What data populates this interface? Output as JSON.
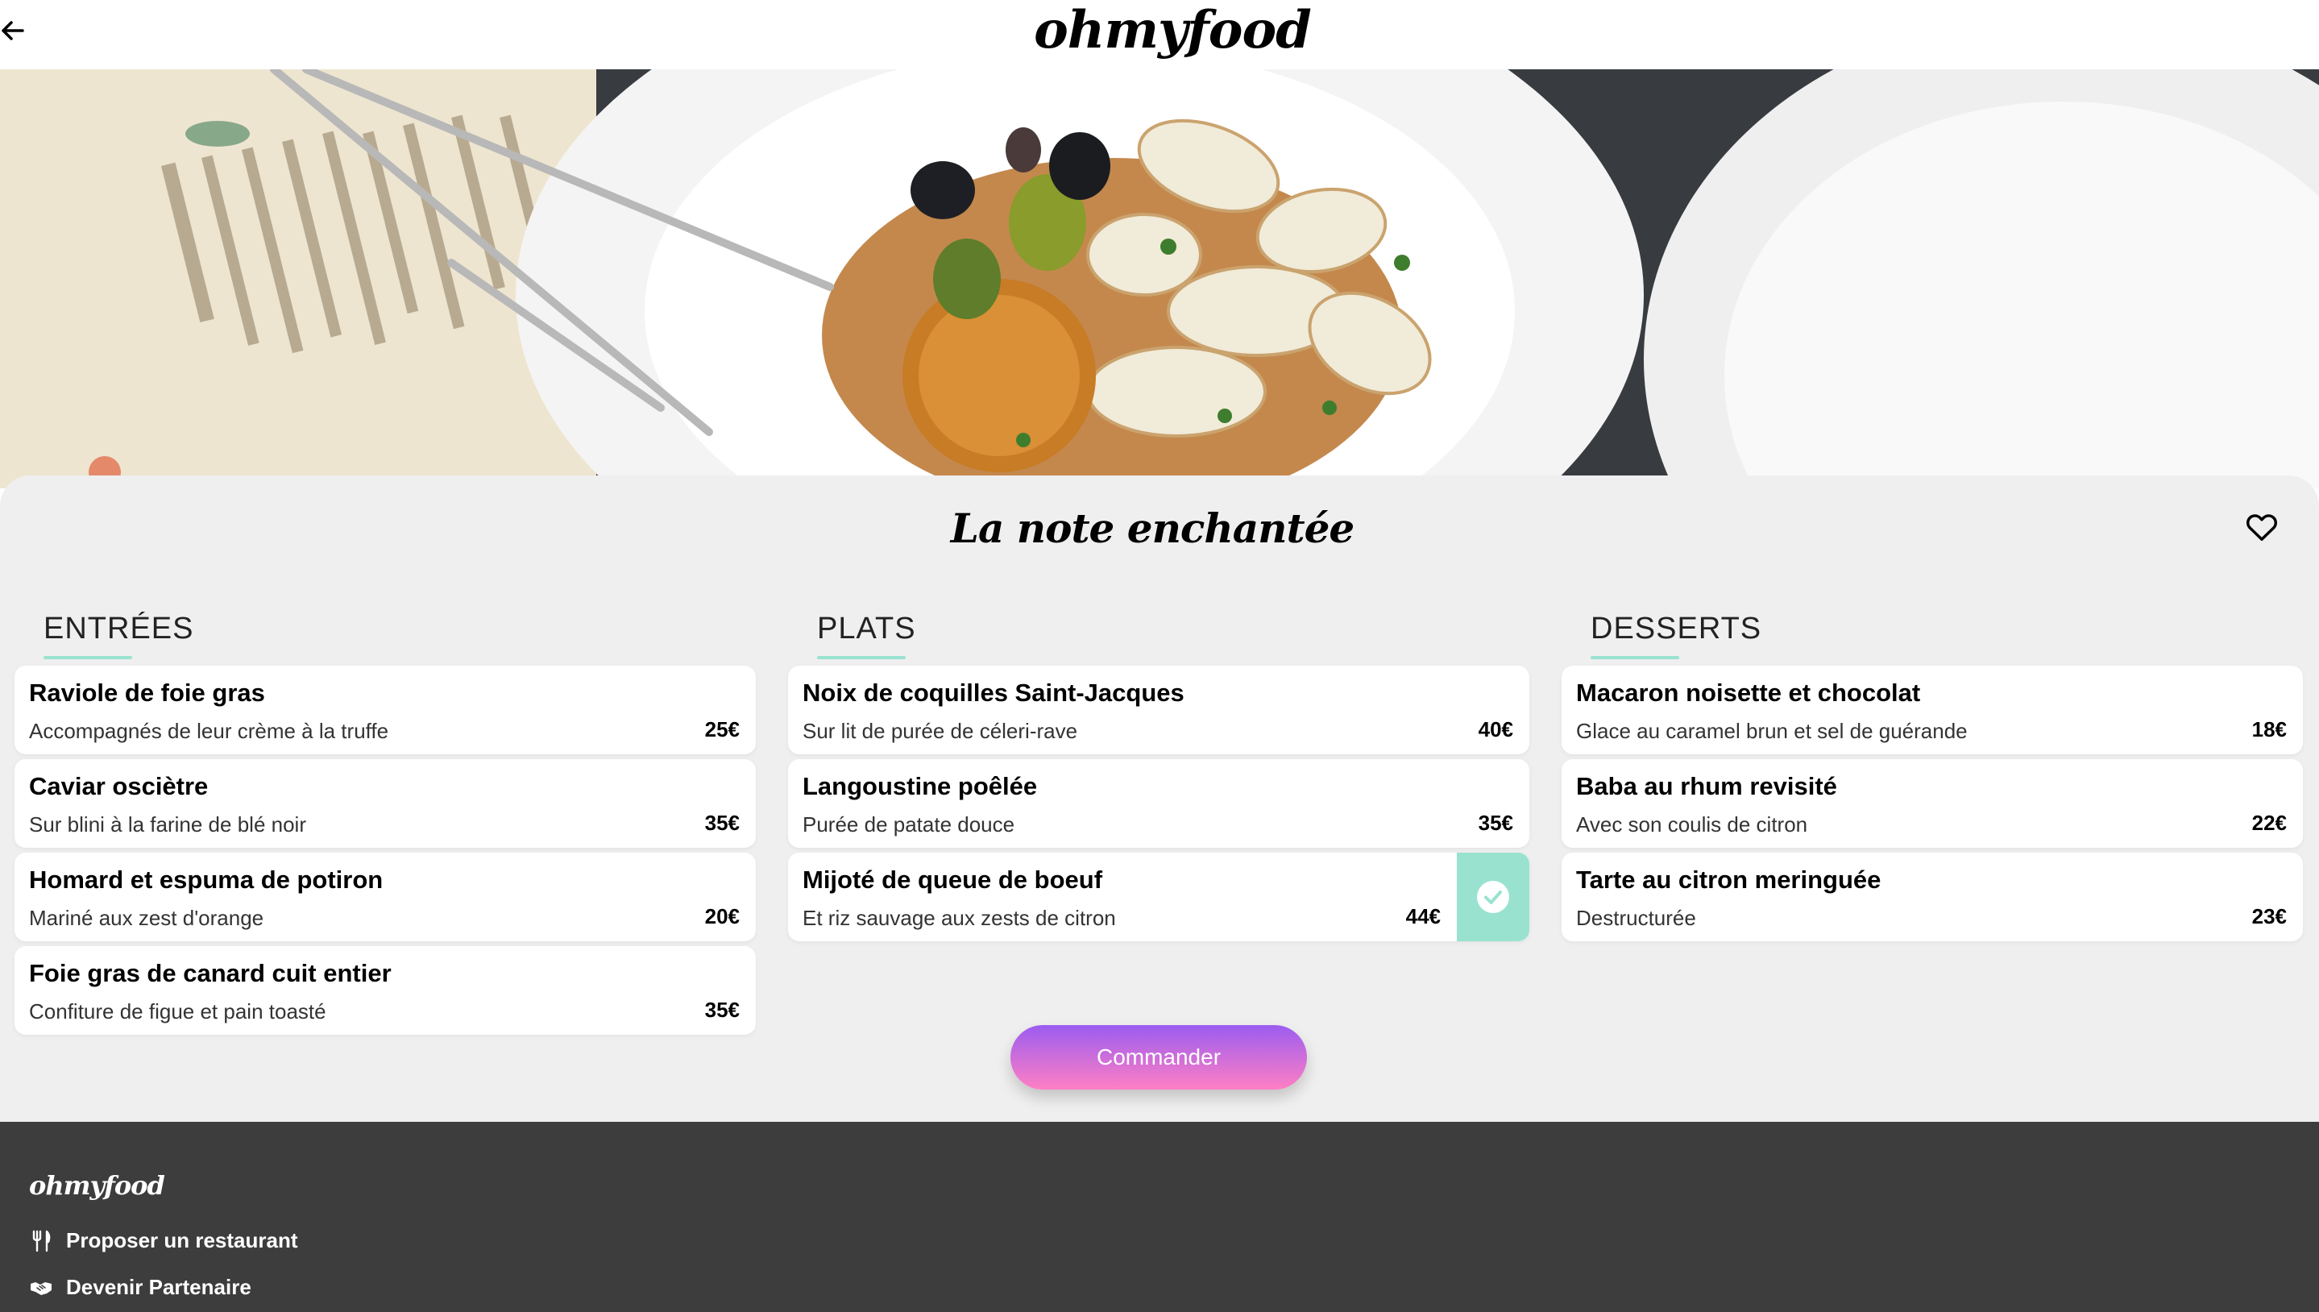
{
  "header": {
    "back_icon": "arrow-left-icon",
    "logo": "ohmyfood"
  },
  "restaurant": {
    "name": "La note enchantée",
    "favorite_icon": "heart-icon"
  },
  "menu": {
    "entrees": {
      "title": "ENTRÉES",
      "items": [
        {
          "name": "Raviole de foie gras",
          "description": "Accompagnés de leur crème à la truffe",
          "price": "25€"
        },
        {
          "name": "Caviar osciètre",
          "description": "Sur blini à la farine de blé noir",
          "price": "35€"
        },
        {
          "name": "Homard et espuma de potiron",
          "description": "Mariné aux zest d'orange",
          "price": "20€"
        },
        {
          "name": "Foie gras de canard cuit entier",
          "description": "Confiture de figue et pain toasté",
          "price": "35€"
        }
      ]
    },
    "plats": {
      "title": "PLATS",
      "items": [
        {
          "name": "Noix de coquilles Saint-Jacques",
          "description": "Sur lit de purée de céleri-rave",
          "price": "40€"
        },
        {
          "name": "Langoustine poêlée",
          "description": "Purée de patate douce",
          "price": "35€"
        },
        {
          "name": "Mijoté de queue de boeuf",
          "description": "Et riz sauvage aux zests de citron",
          "price": "44€",
          "selected": true
        }
      ]
    },
    "desserts": {
      "title": "DESSERTS",
      "items": [
        {
          "name": "Macaron noisette et chocolat",
          "description": "Glace au caramel brun et sel de guérande",
          "price": "18€"
        },
        {
          "name": "Baba au rhum revisité",
          "description": "Avec son coulis de citron",
          "price": "22€"
        },
        {
          "name": "Tarte au citron meringuée",
          "description": "Destructurée",
          "price": "23€"
        }
      ]
    }
  },
  "order_button": {
    "label": "Commander"
  },
  "footer": {
    "logo": "ohmyfood",
    "links": [
      {
        "label": "Proposer un restaurant",
        "icon": "utensils-icon"
      },
      {
        "label": "Devenir Partenaire",
        "icon": "handshake-icon"
      }
    ]
  },
  "colors": {
    "accent_green": "#99e2d0",
    "button_gradient_start": "#9b5cf0",
    "button_gradient_end": "#ff7fc4",
    "footer_bg": "#3d3d3d",
    "panel_bg": "#efefef"
  }
}
